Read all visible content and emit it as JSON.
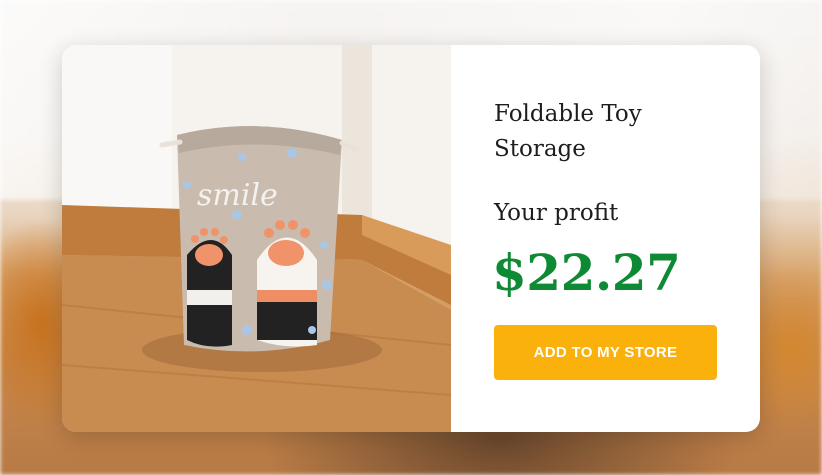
{
  "product": {
    "title": "Foldable Toy Storage",
    "image_text": "smile"
  },
  "profit": {
    "label": "Your profit",
    "amount": "$22.27",
    "color": "#0f8a34"
  },
  "actions": {
    "add_button_label": "ADD TO MY STORE",
    "button_color": "#fbb10c"
  }
}
